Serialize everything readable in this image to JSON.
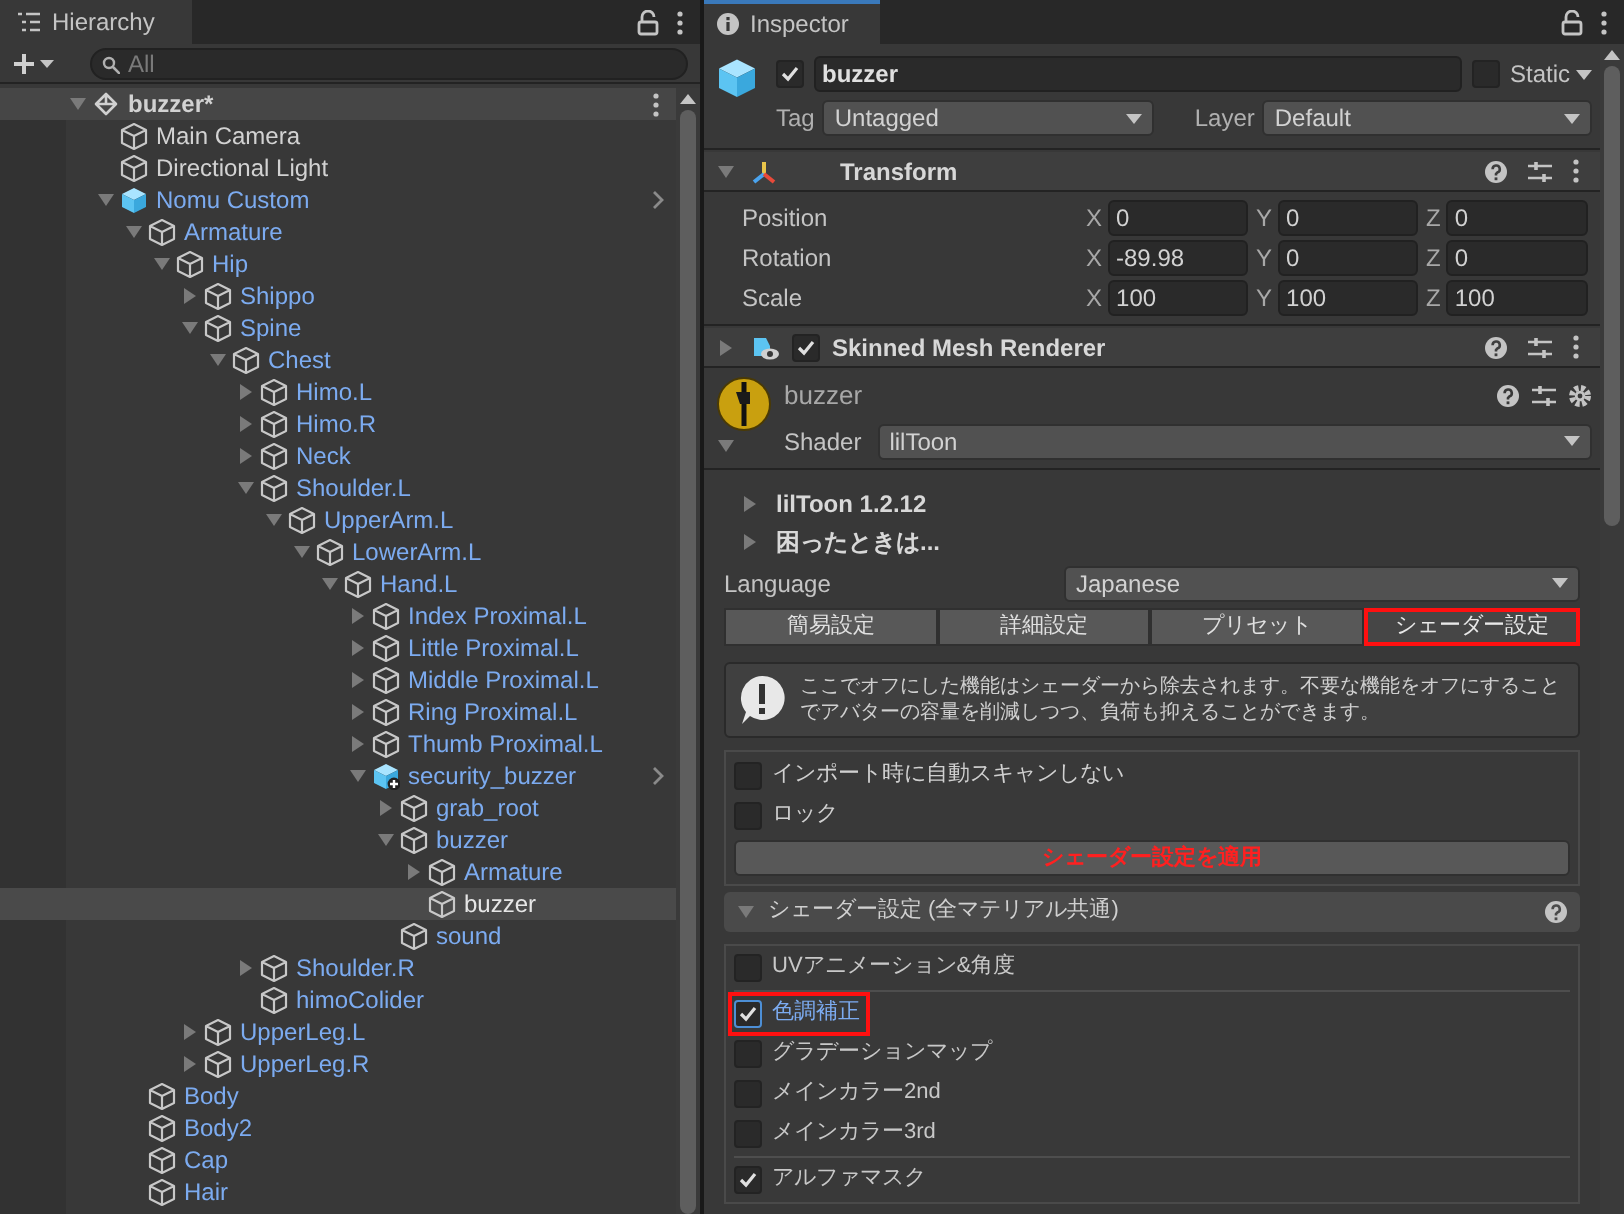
{
  "hierarchy": {
    "tab": "Hierarchy",
    "search": {
      "placeholder": "All"
    },
    "tree": [
      {
        "label": "buzzer*",
        "kind": "scene",
        "prefab": false,
        "selected": false,
        "expanded": true,
        "children": [
          {
            "label": "Main Camera",
            "kind": "gameobject",
            "prefab": false,
            "selected": false
          },
          {
            "label": "Directional Light",
            "kind": "gameobject",
            "prefab": false,
            "selected": false
          },
          {
            "label": "Nomu Custom",
            "kind": "prefab",
            "prefab": true,
            "chevron": true,
            "selected": false,
            "expanded": true,
            "children": [
              {
                "label": "Armature",
                "kind": "gameobject",
                "prefab": true,
                "selected": false,
                "expanded": true,
                "children": [
                  {
                    "label": "Hip",
                    "kind": "gameobject",
                    "prefab": true,
                    "selected": false,
                    "expanded": true,
                    "children": [
                      {
                        "label": "Shippo",
                        "kind": "gameobject",
                        "prefab": true,
                        "selected": false,
                        "expanded": false
                      },
                      {
                        "label": "Spine",
                        "kind": "gameobject",
                        "prefab": true,
                        "selected": false,
                        "expanded": true,
                        "children": [
                          {
                            "label": "Chest",
                            "kind": "gameobject",
                            "prefab": true,
                            "selected": false,
                            "expanded": true,
                            "children": [
                              {
                                "label": "Himo.L",
                                "kind": "gameobject",
                                "prefab": true,
                                "selected": false,
                                "expanded": false
                              },
                              {
                                "label": "Himo.R",
                                "kind": "gameobject",
                                "prefab": true,
                                "selected": false,
                                "expanded": false
                              },
                              {
                                "label": "Neck",
                                "kind": "gameobject",
                                "prefab": true,
                                "selected": false,
                                "expanded": false
                              },
                              {
                                "label": "Shoulder.L",
                                "kind": "gameobject",
                                "prefab": true,
                                "selected": false,
                                "expanded": true,
                                "children": [
                                  {
                                    "label": "UpperArm.L",
                                    "kind": "gameobject",
                                    "prefab": true,
                                    "selected": false,
                                    "expanded": true,
                                    "children": [
                                      {
                                        "label": "LowerArm.L",
                                        "kind": "gameobject",
                                        "prefab": true,
                                        "selected": false,
                                        "expanded": true,
                                        "children": [
                                          {
                                            "label": "Hand.L",
                                            "kind": "gameobject",
                                            "prefab": true,
                                            "selected": false,
                                            "expanded": true,
                                            "children": [
                                              {
                                                "label": "Index Proximal.L",
                                                "kind": "gameobject",
                                                "prefab": true,
                                                "selected": false,
                                                "expanded": false
                                              },
                                              {
                                                "label": "Little Proximal.L",
                                                "kind": "gameobject",
                                                "prefab": true,
                                                "selected": false,
                                                "expanded": false
                                              },
                                              {
                                                "label": "Middle Proximal.L",
                                                "kind": "gameobject",
                                                "prefab": true,
                                                "selected": false,
                                                "expanded": false
                                              },
                                              {
                                                "label": "Ring Proximal.L",
                                                "kind": "gameobject",
                                                "prefab": true,
                                                "selected": false,
                                                "expanded": false
                                              },
                                              {
                                                "label": "Thumb Proximal.L",
                                                "kind": "gameobject",
                                                "prefab": true,
                                                "selected": false,
                                                "expanded": false
                                              },
                                              {
                                                "label": "security_buzzer",
                                                "kind": "added_prefab",
                                                "prefab": true,
                                                "chevron": true,
                                                "selected": false,
                                                "expanded": true,
                                                "children": [
                                                  {
                                                    "label": "grab_root",
                                                    "kind": "gameobject",
                                                    "prefab": true,
                                                    "selected": false,
                                                    "expanded": false
                                                  },
                                                  {
                                                    "label": "buzzer",
                                                    "kind": "gameobject",
                                                    "prefab": true,
                                                    "selected": false,
                                                    "expanded": true,
                                                    "children": [
                                                      {
                                                        "label": "Armature",
                                                        "kind": "gameobject",
                                                        "prefab": true,
                                                        "selected": false,
                                                        "expanded": false
                                                      },
                                                      {
                                                        "label": "buzzer",
                                                        "kind": "gameobject",
                                                        "selected": true
                                                      }
                                                    ]
                                                  },
                                                  {
                                                    "label": "sound",
                                                    "kind": "gameobject",
                                                    "prefab": true,
                                                    "selected": false
                                                  }
                                                ]
                                              }
                                            ]
                                          }
                                        ]
                                      }
                                    ]
                                  }
                                ]
                              },
                              {
                                "label": "Shoulder.R",
                                "kind": "gameobject",
                                "prefab": true,
                                "selected": false,
                                "expanded": false
                              },
                              {
                                "label": "himoColider",
                                "kind": "gameobject",
                                "prefab": true,
                                "selected": false
                              }
                            ]
                          }
                        ]
                      },
                      {
                        "label": "UpperLeg.L",
                        "kind": "gameobject",
                        "prefab": true,
                        "selected": false,
                        "expanded": false
                      },
                      {
                        "label": "UpperLeg.R",
                        "kind": "gameobject",
                        "prefab": true,
                        "selected": false,
                        "expanded": false
                      }
                    ]
                  }
                ]
              },
              {
                "label": "Body",
                "kind": "gameobject",
                "prefab": true,
                "selected": false
              },
              {
                "label": "Body2",
                "kind": "gameobject",
                "prefab": true,
                "selected": false
              },
              {
                "label": "Cap",
                "kind": "gameobject",
                "prefab": true,
                "selected": false
              },
              {
                "label": "Hair",
                "kind": "gameobject",
                "prefab": true,
                "selected": false
              }
            ]
          }
        ]
      }
    ]
  },
  "inspector": {
    "tab": "Inspector",
    "object": {
      "active": true,
      "name": "buzzer",
      "static": false,
      "static_label": "Static",
      "tag_label": "Tag",
      "tag": "Untagged",
      "layer_label": "Layer",
      "layer": "Default"
    },
    "transform": {
      "title": "Transform",
      "expanded": true,
      "rows": [
        {
          "label": "Position",
          "fields": [
            {
              "axis": "X",
              "value": "0"
            },
            {
              "axis": "Y",
              "value": "0"
            },
            {
              "axis": "Z",
              "value": "0"
            }
          ]
        },
        {
          "label": "Rotation",
          "fields": [
            {
              "axis": "X",
              "value": "-89.98"
            },
            {
              "axis": "Y",
              "value": "0"
            },
            {
              "axis": "Z",
              "value": "0"
            }
          ]
        },
        {
          "label": "Scale",
          "fields": [
            {
              "axis": "X",
              "value": "100"
            },
            {
              "axis": "Y",
              "value": "100"
            },
            {
              "axis": "Z",
              "value": "100"
            }
          ]
        }
      ]
    },
    "renderer": {
      "title": "Skinned Mesh Renderer",
      "expanded": false,
      "enabled": true
    },
    "material": {
      "name": "buzzer",
      "expanded": true,
      "shader_label": "Shader",
      "shader": "lilToon"
    },
    "liltoon": {
      "foldouts": [
        {
          "label": "lilToon 1.2.12",
          "expanded": false
        },
        {
          "label": "困ったときは...",
          "expanded": false
        }
      ],
      "language_label": "Language",
      "language": "Japanese",
      "tabs": [
        {
          "label": "簡易設定",
          "selected": false,
          "highlighted": false
        },
        {
          "label": "詳細設定",
          "selected": false,
          "highlighted": false
        },
        {
          "label": "プリセット",
          "selected": false,
          "highlighted": false
        },
        {
          "label": "シェーダー設定",
          "selected": true,
          "highlighted": true
        }
      ],
      "info": "ここでオフにした機能はシェーダーから除去されます。不要な機能をオフにすることでアバターの容量を削減しつつ、負荷も抑えることができます。",
      "options": [
        {
          "label": "インポート時に自動スキャンしない",
          "checked": false
        },
        {
          "label": "ロック",
          "checked": false
        }
      ],
      "apply_button": "シェーダー設定を適用",
      "section": {
        "title": "シェーダー設定 (全マテリアル共通)",
        "expanded": true,
        "groups": [
          [
            {
              "label": "UVアニメーション&角度",
              "checked": false,
              "focused": false,
              "highlighted": false
            }
          ],
          [
            {
              "label": "色調補正",
              "checked": true,
              "focused": true,
              "highlighted": true
            },
            {
              "label": "グラデーションマップ",
              "checked": false,
              "focused": false,
              "highlighted": false
            },
            {
              "label": "メインカラー2nd",
              "checked": false,
              "focused": false,
              "highlighted": false
            },
            {
              "label": "メインカラー3rd",
              "checked": false,
              "focused": false,
              "highlighted": false
            }
          ],
          [
            {
              "label": "アルファマスク",
              "checked": true,
              "focused": false,
              "highlighted": false
            }
          ]
        ]
      }
    }
  }
}
